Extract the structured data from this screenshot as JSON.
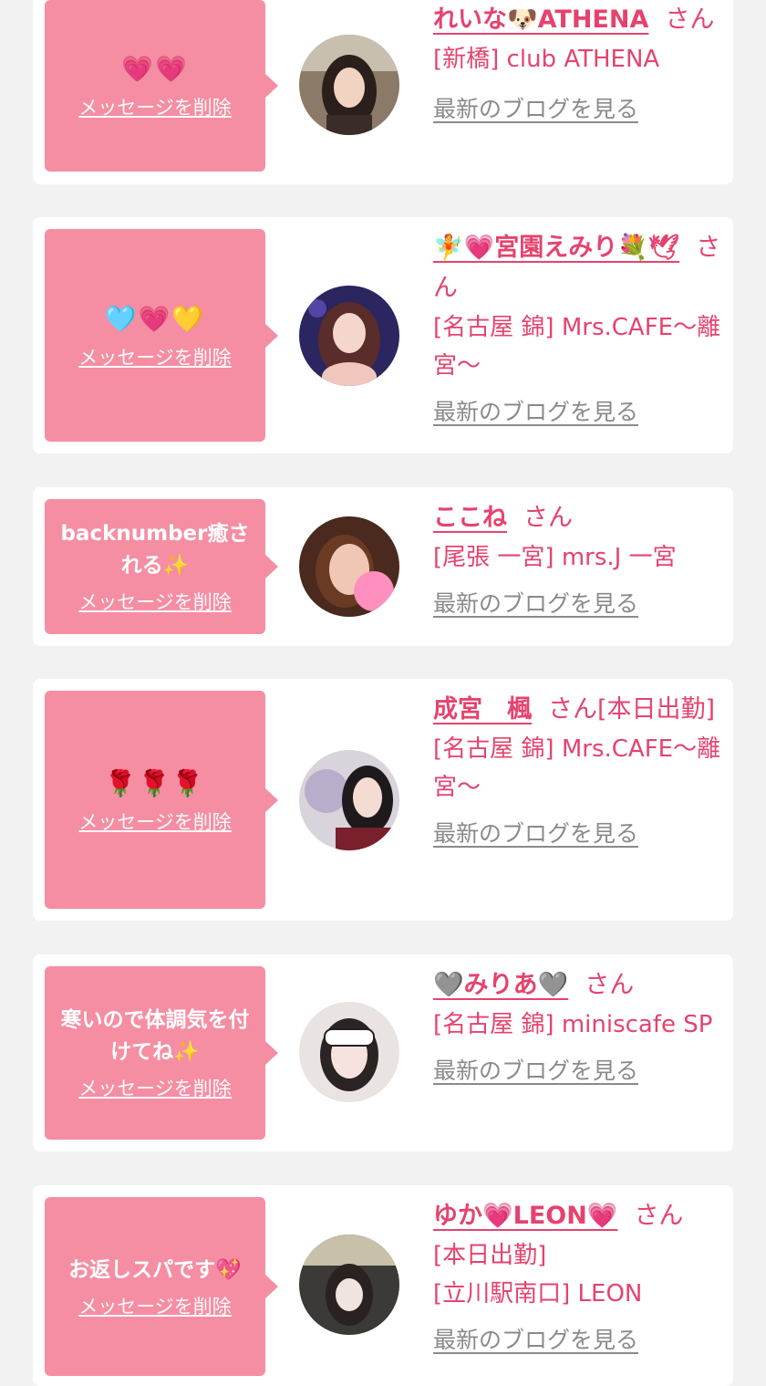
{
  "cards": [
    {
      "message": "💗💗",
      "delete_label": "メッセージを削除",
      "name": "れいな🐶ATHENA",
      "honorific": "さん",
      "shop": "[新橋] club ATHENA",
      "blog_link": "最新のブログを見る"
    },
    {
      "message": "🩵💗💛",
      "delete_label": "メッセージを削除",
      "name": "🧚💗宮園えみり💐🕊",
      "honorific": "さん",
      "shop": "[名古屋 錦] Mrs.CAFE〜離宮〜",
      "blog_link": "最新のブログを見る"
    },
    {
      "message": "backnumber癒される✨",
      "delete_label": "メッセージを削除",
      "name": "ここね",
      "honorific": "さん",
      "shop": "[尾張 一宮] mrs.J 一宮",
      "blog_link": "最新のブログを見る"
    },
    {
      "message": "🌹🌹🌹",
      "delete_label": "メッセージを削除",
      "name": "成宮　楓",
      "honorific": "さん[本日出勤]",
      "shop": "[名古屋 錦] Mrs.CAFE〜離宮〜",
      "blog_link": "最新のブログを見る"
    },
    {
      "message": "寒いので体調気を付けてね✨",
      "delete_label": "メッセージを削除",
      "name": "🩶みりあ🩶",
      "honorific": "さん",
      "shop": "[名古屋 錦] miniscafe SP",
      "blog_link": "最新のブログを見る"
    },
    {
      "message": "お返しスパです💖",
      "delete_label": "メッセージを削除",
      "name": "ゆか💗LEON💗",
      "honorific": "さん",
      "status": "[本日出勤]",
      "shop": "[立川駅南口] LEON",
      "blog_link": "最新のブログを見る"
    }
  ],
  "colors": {
    "bubble": "#f58ea3",
    "accent": "#e5436e",
    "background": "#f2f2f2",
    "link_gray": "#8a8a8a"
  }
}
